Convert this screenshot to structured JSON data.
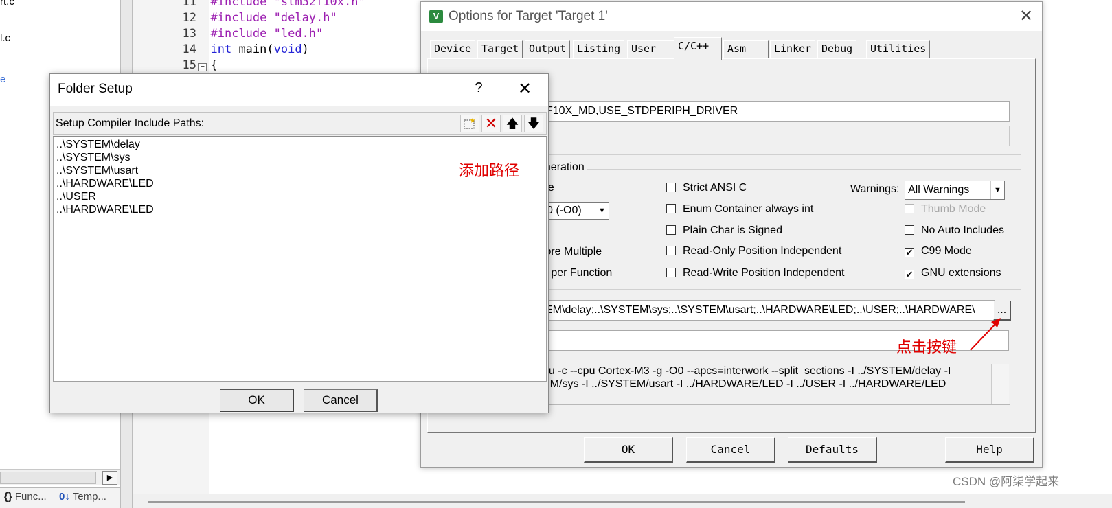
{
  "ide": {
    "tree_items": [
      "rt.c",
      "l.c",
      "e"
    ],
    "left_tabs": [
      {
        "icon": "{}",
        "label": "Func..."
      },
      {
        "icon": "0↓",
        "label": "Temp..."
      }
    ],
    "code_lines": [
      {
        "num": "11",
        "pre": "#include",
        "arg": "\"stm32f10x.h\""
      },
      {
        "num": "12",
        "pre": "#include",
        "arg": "\"delay.h\""
      },
      {
        "num": "13",
        "pre": "#include",
        "arg": "\"led.h\""
      },
      {
        "num": "14",
        "kw1": "int",
        "mid": " main(",
        "kw2": "void",
        "end": ")"
      },
      {
        "num": "15",
        "brace": "{"
      }
    ]
  },
  "options": {
    "title": "Options for Target 'Target 1'",
    "app_icon": "V",
    "tabs": [
      "Device",
      "Target",
      "Output",
      "Listing",
      "User",
      "C/C++",
      "Asm",
      "Linker",
      "Debug",
      "Utilities"
    ],
    "active_tab": "C/C++",
    "define_legend": "ls",
    "define_value": "F10X_MD,USE_STDPERIPH_DRIVER",
    "codegen_legend": "eneration",
    "left_fragments": [
      "de",
      "e",
      "tore Multiple",
      "n per Function"
    ],
    "optimization_value": "0 (-O0)",
    "checkboxes_mid": [
      {
        "label": "Strict ANSI C",
        "checked": false
      },
      {
        "label": "Enum Container always int",
        "checked": false
      },
      {
        "label": "Plain Char is Signed",
        "checked": false
      },
      {
        "label": "Read-Only Position Independent",
        "checked": false
      },
      {
        "label": "Read-Write Position Independent",
        "checked": false
      }
    ],
    "warnings_label": "Warnings:",
    "warnings_value": "All Warnings",
    "checkboxes_right": [
      {
        "label": "Thumb Mode",
        "checked": false,
        "disabled": true
      },
      {
        "label": "No Auto Includes",
        "checked": false,
        "disabled": false
      },
      {
        "label": "C99 Mode",
        "checked": true,
        "disabled": false
      },
      {
        "label": "GNU extensions",
        "checked": true,
        "disabled": false
      }
    ],
    "include_paths": "EM\\delay;..\\SYSTEM\\sys;..\\SYSTEM\\usart;..\\HARDWARE\\LED;..\\USER;..\\HARDWARE\\",
    "browse_label": "...",
    "compiler_control_1": "nu -c --cpu Cortex-M3 -g -O0 --apcs=interwork --split_sections -I ../SYSTEM/delay -I",
    "compiler_control_2": "EM/sys -I ../SYSTEM/usart -I ../HARDWARE/LED -I ../USER -I ../HARDWARE/LED",
    "buttons": {
      "ok": "OK",
      "cancel": "Cancel",
      "defaults": "Defaults",
      "help": "Help"
    },
    "annotation_click": "点击按键"
  },
  "folder": {
    "title": "Folder Setup",
    "help": "?",
    "header_label": "Setup Compiler Include Paths:",
    "paths": [
      "..\\SYSTEM\\delay",
      "..\\SYSTEM\\sys",
      "..\\SYSTEM\\usart",
      "..\\HARDWARE\\LED",
      "..\\USER",
      "..\\HARDWARE\\LED"
    ],
    "annotation_add": "添加路径",
    "buttons": {
      "ok": "OK",
      "cancel": "Cancel"
    }
  },
  "watermark": "CSDN @阿柒学起来",
  "colors": {
    "annotation": "#e00000",
    "keyword": "#2323d6",
    "preprocessor": "#9b1db0"
  }
}
